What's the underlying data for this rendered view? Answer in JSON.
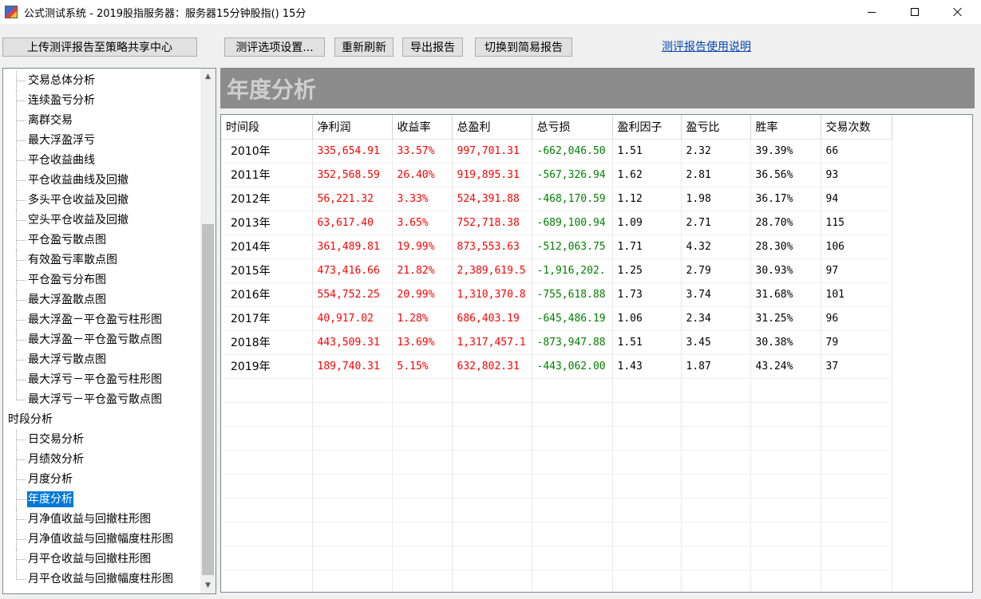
{
  "window": {
    "title": "公式测试系统 - 2019股指服务器：服务器15分钟股指() 15分",
    "app_icon": "app-icon"
  },
  "toolbar": {
    "upload_label": "上传测评报告至策略共享中心",
    "options_label": "测评选项设置...",
    "refresh_label": "重新刷新",
    "export_label": "导出报告",
    "switch_label": "切换到简易报告",
    "help_link": "测评报告使用说明"
  },
  "tree": {
    "items": [
      {
        "label": "交易总体分析",
        "level": 1
      },
      {
        "label": "连续盈亏分析",
        "level": 1
      },
      {
        "label": "离群交易",
        "level": 1
      },
      {
        "label": "最大浮盈浮亏",
        "level": 1
      },
      {
        "label": "平仓收益曲线",
        "level": 1
      },
      {
        "label": "平仓收益曲线及回撤",
        "level": 1
      },
      {
        "label": "多头平仓收益及回撤",
        "level": 1
      },
      {
        "label": "空头平仓收益及回撤",
        "level": 1
      },
      {
        "label": "平仓盈亏散点图",
        "level": 1
      },
      {
        "label": "有效盈亏率散点图",
        "level": 1
      },
      {
        "label": "平仓盈亏分布图",
        "level": 1
      },
      {
        "label": "最大浮盈散点图",
        "level": 1
      },
      {
        "label": "最大浮盈－平仓盈亏柱形图",
        "level": 1
      },
      {
        "label": "最大浮盈－平仓盈亏散点图",
        "level": 1
      },
      {
        "label": "最大浮亏散点图",
        "level": 1
      },
      {
        "label": "最大浮亏－平仓盈亏柱形图",
        "level": 1
      },
      {
        "label": "最大浮亏－平仓盈亏散点图",
        "level": 1,
        "last": true
      },
      {
        "label": "时段分析",
        "level": 0
      },
      {
        "label": "日交易分析",
        "level": 1
      },
      {
        "label": "月绩效分析",
        "level": 1
      },
      {
        "label": "月度分析",
        "level": 1
      },
      {
        "label": "年度分析",
        "level": 1,
        "selected": true
      },
      {
        "label": "月净值收益与回撤柱形图",
        "level": 1
      },
      {
        "label": "月净值收益与回撤幅度柱形图",
        "level": 1
      },
      {
        "label": "月平仓收益与回撤柱形图",
        "level": 1
      },
      {
        "label": "月平仓收益与回撤幅度柱形图",
        "level": 1,
        "last": true
      }
    ]
  },
  "section": {
    "title": "年度分析"
  },
  "table": {
    "columns": [
      "时间段",
      "净利润",
      "收益率",
      "总盈利",
      "总亏损",
      "盈利因子",
      "盈亏比",
      "胜率",
      "交易次数"
    ],
    "rows": [
      [
        "2010年",
        "335,654.91",
        "33.57%",
        "997,701.31",
        "-662,046.50",
        "1.51",
        "2.32",
        "39.39%",
        "66"
      ],
      [
        "2011年",
        "352,568.59",
        "26.40%",
        "919,895.31",
        "-567,326.94",
        "1.62",
        "2.81",
        "36.56%",
        "93"
      ],
      [
        "2012年",
        "56,221.32",
        "3.33%",
        "524,391.88",
        "-468,170.59",
        "1.12",
        "1.98",
        "36.17%",
        "94"
      ],
      [
        "2013年",
        "63,617.40",
        "3.65%",
        "752,718.38",
        "-689,100.94",
        "1.09",
        "2.71",
        "28.70%",
        "115"
      ],
      [
        "2014年",
        "361,489.81",
        "19.99%",
        "873,553.63",
        "-512,063.75",
        "1.71",
        "4.32",
        "28.30%",
        "106"
      ],
      [
        "2015年",
        "473,416.66",
        "21.82%",
        "2,389,619.5",
        "-1,916,202.",
        "1.25",
        "2.79",
        "30.93%",
        "97"
      ],
      [
        "2016年",
        "554,752.25",
        "20.99%",
        "1,310,370.8",
        "-755,618.88",
        "1.73",
        "3.74",
        "31.68%",
        "101"
      ],
      [
        "2017年",
        "40,917.02",
        "1.28%",
        "686,403.19",
        "-645,486.19",
        "1.06",
        "2.34",
        "31.25%",
        "96"
      ],
      [
        "2018年",
        "443,509.31",
        "13.69%",
        "1,317,457.1",
        "-873,947.88",
        "1.51",
        "3.45",
        "30.38%",
        "79"
      ],
      [
        "2019年",
        "189,740.31",
        "5.15%",
        "632,802.31",
        "-443,062.00",
        "1.43",
        "1.87",
        "43.24%",
        "37"
      ]
    ],
    "empty_rows": 9
  },
  "colors": {
    "positive": "#ff0000",
    "negative": "#008000",
    "selection": "#0078d7",
    "banner": "#8c8c8c"
  }
}
